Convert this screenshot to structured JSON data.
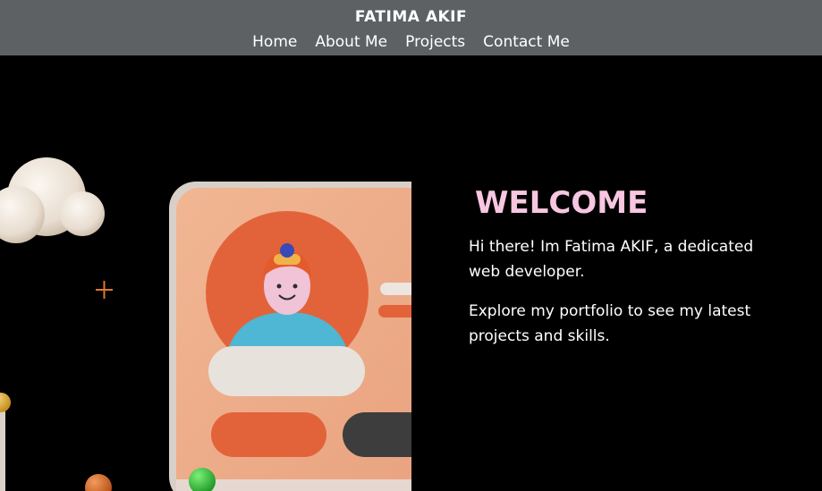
{
  "header": {
    "brand": "FATIMA AKIF",
    "nav": [
      "Home",
      "About Me",
      "Projects",
      "Contact Me"
    ]
  },
  "hero": {
    "heading": "WELCOME",
    "intro": "Hi there! Im Fatima AKIF, a dedicated web developer.",
    "explore": "Explore my portfolio to see my latest projects and skills."
  },
  "colors": {
    "header_bg": "#5d6164",
    "page_bg": "#000000",
    "heading": "#f7c6e0",
    "text": "#ffffff"
  }
}
